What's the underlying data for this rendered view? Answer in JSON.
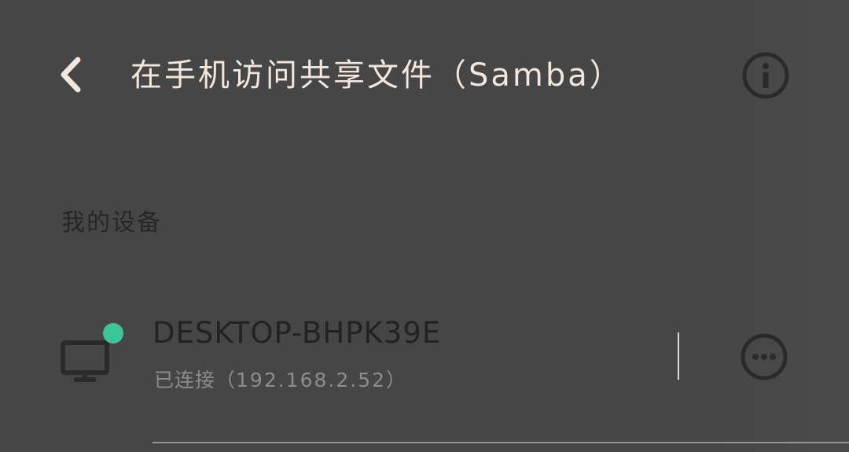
{
  "header": {
    "title": "在手机访问共享文件（Samba）",
    "back_icon": "chevron-left-icon",
    "info_icon": "info-icon"
  },
  "section": {
    "label": "我的设备"
  },
  "device": {
    "name": "DESKTOP-BHPK39E",
    "status_prefix": "已连接（",
    "ip": "192.168.2.52",
    "status_suffix": "）",
    "icon": "monitor-icon",
    "online_color": "#3cc59a",
    "more_icon": "more-options-icon"
  },
  "colors": {
    "background": "#464646",
    "title_text": "#f3e6dc",
    "online_dot": "#3cc59a"
  }
}
